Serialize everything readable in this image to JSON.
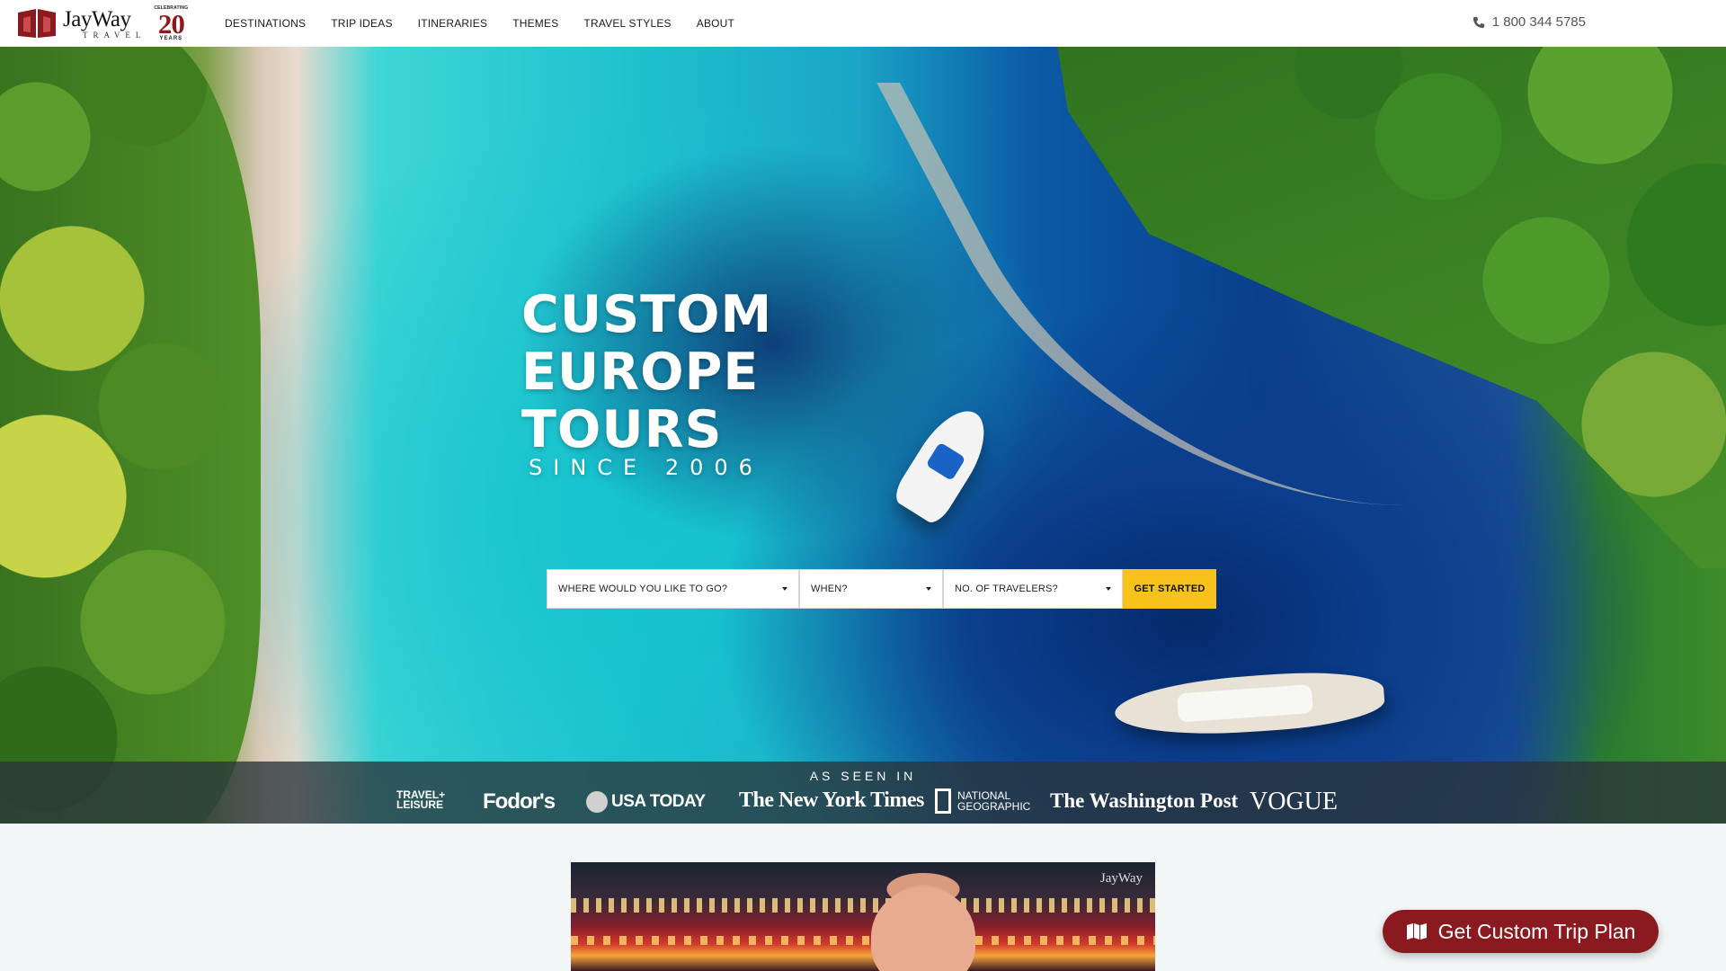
{
  "header": {
    "logo": {
      "name": "JayWay",
      "sub": "TRAVEL",
      "badge_top": "CELEBRATING",
      "badge_number": "20",
      "badge_bottom": "YEARS"
    },
    "nav": [
      {
        "label": "DESTINATIONS"
      },
      {
        "label": "TRIP IDEAS"
      },
      {
        "label": "ITINERARIES"
      },
      {
        "label": "THEMES"
      },
      {
        "label": "TRAVEL STYLES"
      },
      {
        "label": "ABOUT"
      }
    ],
    "phone": "1 800 344 5785",
    "phone_icon": "phone-icon"
  },
  "hero": {
    "title_lines": [
      "CUSTOM",
      "EUROPE",
      "TOURS"
    ],
    "subtitle": "SINCE 2006",
    "search": {
      "destination_label": "WHERE WOULD YOU LIKE TO GO?",
      "when_label": "WHEN?",
      "travelers_label": "NO. OF TRAVELERS?",
      "submit_label": "GET STARTED"
    }
  },
  "press": {
    "title": "AS SEEN IN",
    "logos": {
      "travel_leisure_1": "TRAVEL+",
      "travel_leisure_2": "LEISURE",
      "fodors": "Fodor's",
      "usa_today": "USA TODAY",
      "nyt": "The New York Times",
      "natgeo_1": "NATIONAL",
      "natgeo_2": "GEOGRAPHIC",
      "washington_post": "The Washington Post",
      "vogue": "VOGUE"
    }
  },
  "video": {
    "watermark": "JayWay"
  },
  "cta": {
    "label": "Get Custom Trip Plan",
    "icon": "map-icon"
  },
  "colors": {
    "brand_red": "#8b1a20",
    "cta_yellow": "#f7c21c"
  }
}
